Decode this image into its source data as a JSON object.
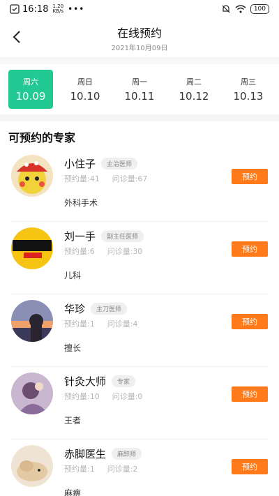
{
  "status_bar": {
    "time": "16:18",
    "net_speed_value": "1.20",
    "net_speed_unit": "KB/s",
    "more": "•••",
    "battery": "100"
  },
  "header": {
    "title": "在线预约",
    "date": "2021年10月09日"
  },
  "date_tabs": [
    {
      "weekday": "周六",
      "date": "10.09",
      "active": true
    },
    {
      "weekday": "周日",
      "date": "10.10",
      "active": false
    },
    {
      "weekday": "周一",
      "date": "10.11",
      "active": false
    },
    {
      "weekday": "周二",
      "date": "10.12",
      "active": false
    },
    {
      "weekday": "周三",
      "date": "10.13",
      "active": false
    }
  ],
  "section_title": "可预约的专家",
  "doctors": [
    {
      "name": "小住子",
      "title": "主治医师",
      "booked": "预约量:41",
      "consults": "问诊量:67",
      "specialty": "外科手术",
      "button": "预约",
      "avatar_icon": "pokemon-avatar"
    },
    {
      "name": "刘一手",
      "title": "副主任医师",
      "booked": "预约量:6",
      "consults": "问诊量:30",
      "specialty": "儿科",
      "button": "预约",
      "avatar_icon": "logo-avatar"
    },
    {
      "name": "华珍",
      "title": "主刀医师",
      "booked": "预约量:1",
      "consults": "问诊量:4",
      "specialty": "擅长",
      "button": "预约",
      "avatar_icon": "sunset-avatar"
    },
    {
      "name": "针灸大师",
      "title": "专家",
      "booked": "预约量:10",
      "consults": "问诊量:0",
      "specialty": "王者",
      "button": "预约",
      "avatar_icon": "game-avatar"
    },
    {
      "name": "赤脚医生",
      "title": "麻醉师",
      "booked": "预约量:1",
      "consults": "问诊量:2",
      "specialty": "麻痹",
      "button": "预约",
      "avatar_icon": "dog-avatar"
    }
  ],
  "colors": {
    "active_tab": "#23c993",
    "book_button": "#ff7a1a"
  }
}
